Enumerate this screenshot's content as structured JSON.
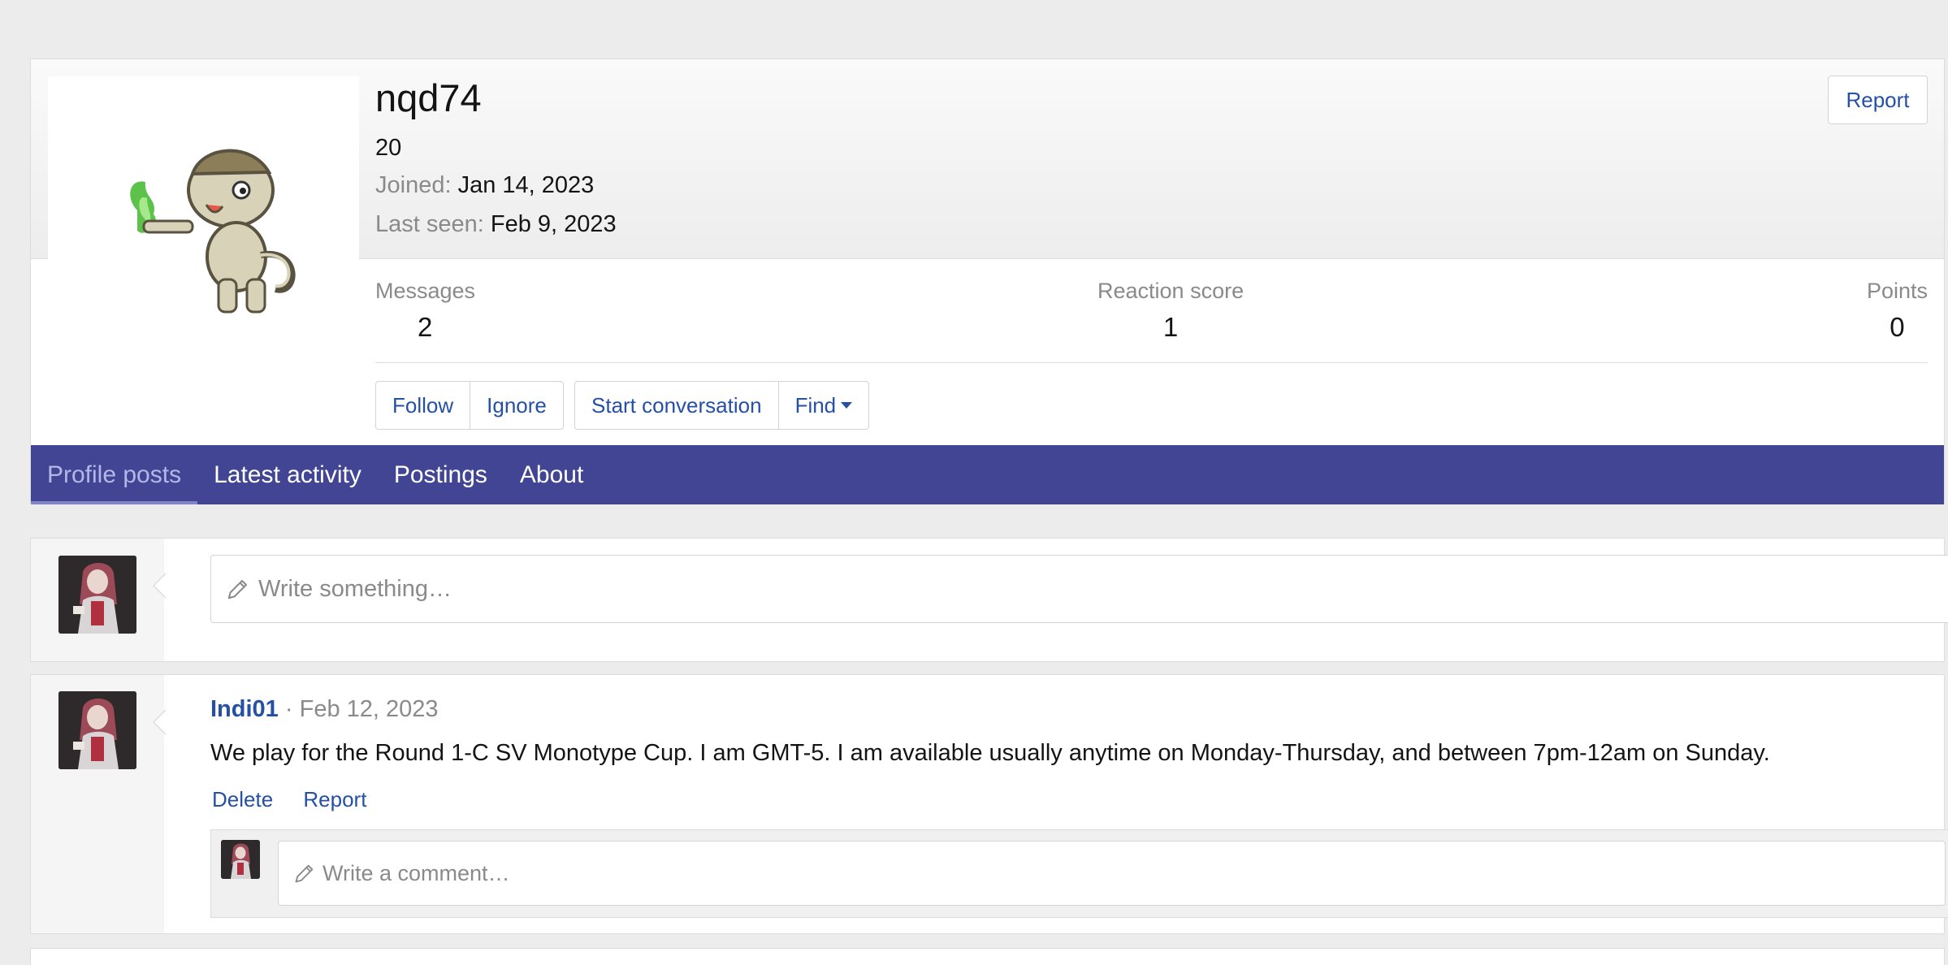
{
  "profile": {
    "username": "nqd74",
    "user_title": "20",
    "joined_label": "Joined:",
    "joined_value": "Jan 14, 2023",
    "last_seen_label": "Last seen:",
    "last_seen_value": "Feb 9, 2023",
    "report_label": "Report",
    "stats": [
      {
        "label": "Messages",
        "value": "2"
      },
      {
        "label": "Reaction score",
        "value": "1"
      },
      {
        "label": "Points",
        "value": "0"
      }
    ],
    "buttons": {
      "follow": "Follow",
      "ignore": "Ignore",
      "start_conversation": "Start conversation",
      "find": "Find"
    }
  },
  "tabs": [
    {
      "label": "Profile posts",
      "active": true
    },
    {
      "label": "Latest activity"
    },
    {
      "label": "Postings"
    },
    {
      "label": "About"
    }
  ],
  "composer": {
    "placeholder": "Write something…"
  },
  "post": {
    "author": "Indi01",
    "separator": "·",
    "date": "Feb 12, 2023",
    "body": "We play for the Round 1-C SV Monotype Cup. I am GMT-5. I am available usually anytime on Monday-Thursday, and between 7pm-12am on Sunday.",
    "delete_label": "Delete",
    "report_label": "Report",
    "comment_placeholder": "Write a comment…"
  },
  "colors": {
    "tab_bar": "#424593",
    "link": "#2550a5",
    "muted": "#8a8a8a"
  }
}
